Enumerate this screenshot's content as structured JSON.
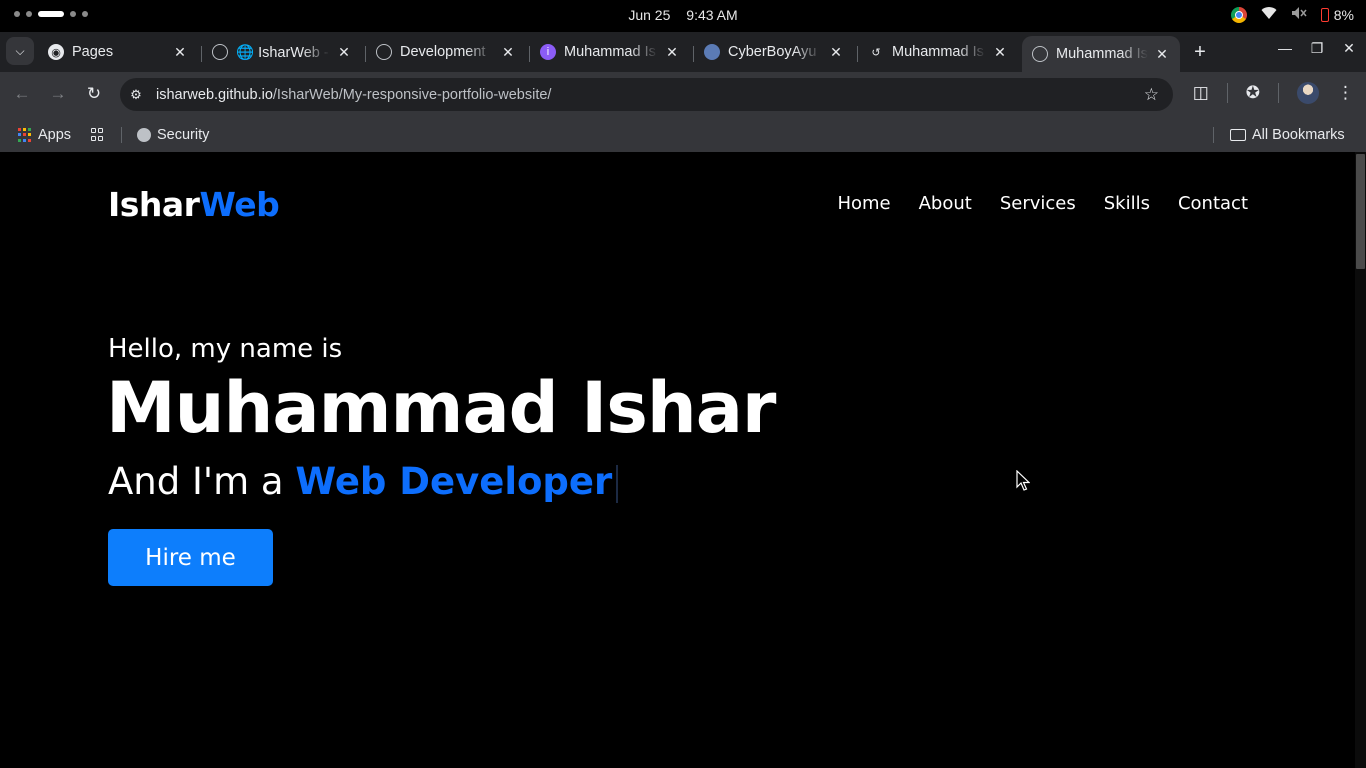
{
  "os": {
    "date": "Jun 25",
    "time": "9:43 AM",
    "battery": "8%"
  },
  "tabs": [
    {
      "title": "Pages",
      "favicon": "github-icon"
    },
    {
      "title": "🌐 IsharWeb - f",
      "favicon": "globe-icon"
    },
    {
      "title": "Development",
      "favicon": "globe-icon"
    },
    {
      "title": "Muhammad Is",
      "favicon": "purple-logo-icon"
    },
    {
      "title": "CyberBoyAyu",
      "favicon": "avatar-icon"
    },
    {
      "title": "Muhammad Is",
      "favicon": "swirl-icon"
    },
    {
      "title": "Muhammad Is",
      "favicon": "globe-icon",
      "active": true
    }
  ],
  "toolbar": {
    "url_domain": "isharweb.github.io",
    "url_path": "/IsharWeb/My-responsive-portfolio-website/"
  },
  "bookmarks": {
    "apps": "Apps",
    "security": "Security",
    "all_bookmarks": "All Bookmarks"
  },
  "site": {
    "logo_main": "Ishar",
    "logo_accent": "Web",
    "nav": [
      "Home",
      "About",
      "Services",
      "Skills",
      "Contact"
    ],
    "hello": "Hello, my name is",
    "name": "Muhammad Ishar",
    "role_prefix": "And I'm a ",
    "role": "Web Developer",
    "cta": "Hire me"
  },
  "colors": {
    "accent": "#0d6efd",
    "button": "#0d7efc",
    "background": "#000000",
    "chrome_dark": "#202124",
    "chrome_toolbar": "#35363a"
  }
}
